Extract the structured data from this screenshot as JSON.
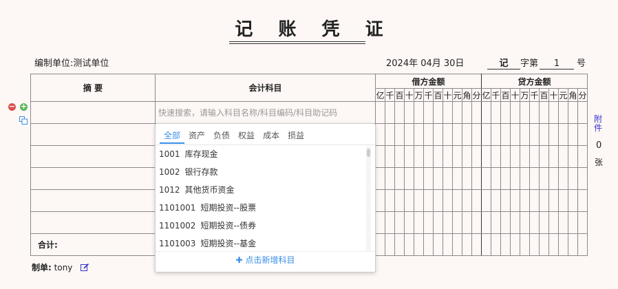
{
  "voucher": {
    "title": "记 账 凭 证",
    "unit_label": "编制单位:",
    "unit_value": "测试单位",
    "date": "2024年 04月 30日",
    "type_value": "记",
    "type_label": "字第",
    "number_value": "1",
    "number_label": "号"
  },
  "table": {
    "summary_header": "摘 要",
    "account_header": "会计科目",
    "debit_header": "借方金额",
    "credit_header": "贷方金额",
    "digits": [
      "亿",
      "千",
      "百",
      "十",
      "万",
      "千",
      "百",
      "十",
      "元",
      "角",
      "分"
    ],
    "search_placeholder": "快速搜索，请输入科目名称/科目编码/科目助记码",
    "total_label": "合计:"
  },
  "dropdown": {
    "tabs": [
      "全部",
      "资产",
      "负债",
      "权益",
      "成本",
      "损益"
    ],
    "active_tab": "全部",
    "items": [
      {
        "code": "1001",
        "name": "库存现金"
      },
      {
        "code": "1002",
        "name": "银行存款"
      },
      {
        "code": "1012",
        "name": "其他货币资金"
      },
      {
        "code": "1101001",
        "name": "短期投资--股票"
      },
      {
        "code": "1101002",
        "name": "短期投资--债券"
      },
      {
        "code": "1101003",
        "name": "短期投资--基金"
      }
    ],
    "add_label": "点击新增科目"
  },
  "attachment": {
    "label_line1": "附",
    "label_line2": "件",
    "count": "0",
    "unit": "张"
  },
  "footer": {
    "maker_label": "制单:",
    "maker_name": "tony"
  },
  "colors": {
    "accent": "#3a8ee6",
    "remove": "#d9534f",
    "add": "#5cb85c"
  }
}
